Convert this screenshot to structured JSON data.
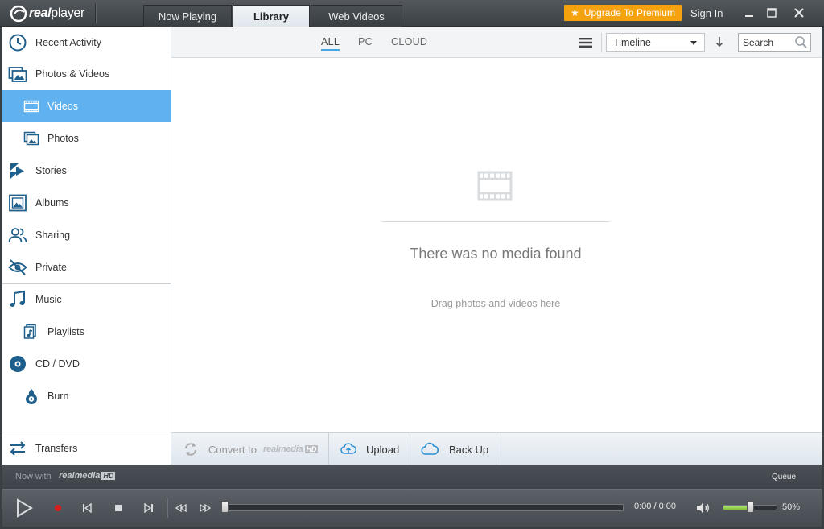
{
  "app": {
    "logo_text_bold": "real",
    "logo_text": "player"
  },
  "titlebar": {
    "tabs": [
      {
        "label": "Now Playing",
        "active": false
      },
      {
        "label": "Library",
        "active": true
      },
      {
        "label": "Web Videos",
        "active": false
      }
    ],
    "premium_label": "Upgrade To Premium",
    "signin_label": "Sign In"
  },
  "sidebar": {
    "items": [
      {
        "label": "Recent Activity",
        "icon": "clock-icon"
      },
      {
        "label": "Photos & Videos",
        "icon": "photos-videos-icon"
      },
      {
        "label": "Videos",
        "icon": "film-icon",
        "active": true
      },
      {
        "label": "Photos",
        "icon": "photo-icon"
      },
      {
        "label": "Stories",
        "icon": "stories-icon"
      },
      {
        "label": "Albums",
        "icon": "album-icon"
      },
      {
        "label": "Sharing",
        "icon": "people-icon"
      },
      {
        "label": "Private",
        "icon": "eye-slash-icon"
      },
      {
        "label": "Music",
        "icon": "music-note-icon"
      },
      {
        "label": "Playlists",
        "icon": "playlist-icon"
      },
      {
        "label": "CD / DVD",
        "icon": "disc-icon"
      },
      {
        "label": "Burn",
        "icon": "burn-icon"
      },
      {
        "label": "Transfers",
        "icon": "transfer-arrows-icon"
      }
    ]
  },
  "toolbar": {
    "filters": [
      {
        "label": "ALL",
        "active": true
      },
      {
        "label": "PC",
        "active": false
      },
      {
        "label": "CLOUD",
        "active": false
      }
    ],
    "sort_value": "Timeline",
    "search_placeholder": "Search"
  },
  "empty_state": {
    "title": "There was no media found",
    "subtitle": "Drag photos and videos here"
  },
  "actions": {
    "convert_label": "Convert to",
    "convert_brand": "realmedia",
    "convert_brand_hd": "HD",
    "upload_label": "Upload",
    "backup_label": "Back Up"
  },
  "player": {
    "now_with_label": "Now with",
    "now_with_brand": "realmedia",
    "now_with_brand_hd": "HD",
    "queue_label": "Queue",
    "time": "0:00 / 0:00",
    "seek_progress": 0,
    "volume_pct": 0.5,
    "volume_label": "50%"
  },
  "colors": {
    "accent": "#5fb2ef",
    "premium": "#f5a20f",
    "icon_blue": "#1f5f8b",
    "record_red": "#e01b1b",
    "volume_green": "#7dc23a"
  }
}
